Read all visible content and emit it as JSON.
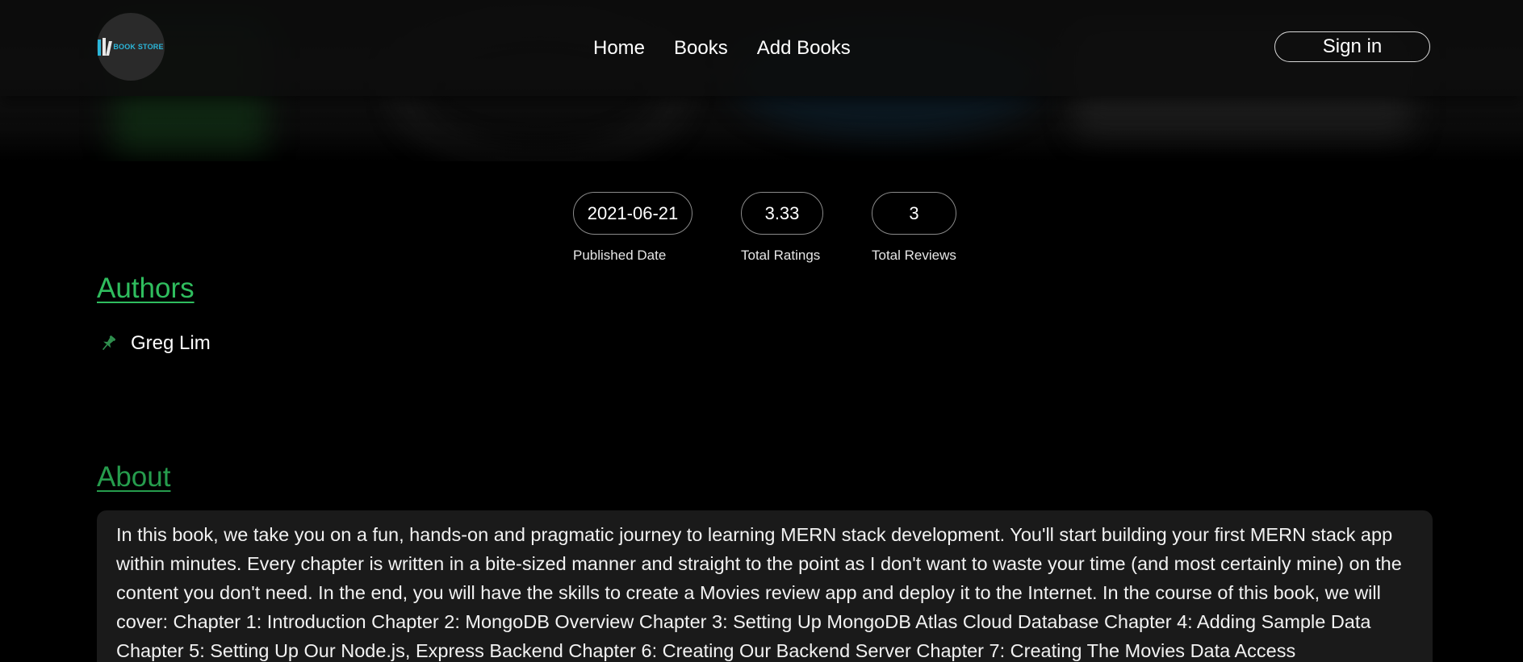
{
  "logo": {
    "text": "BOOK STORE",
    "icon": "book-stack-icon",
    "accent": "#2bb6d9"
  },
  "nav": {
    "links": [
      "Home",
      "Books",
      "Add Books"
    ],
    "signin_label": "Sign in"
  },
  "stats": [
    {
      "value": "2021-06-21",
      "label": "Published Date"
    },
    {
      "value": "3.33",
      "label": "Total Ratings"
    },
    {
      "value": "3",
      "label": "Total Reviews"
    }
  ],
  "authors": {
    "title": "Authors",
    "icon": "pin-icon",
    "items": [
      "Greg Lim"
    ]
  },
  "about": {
    "title": "About",
    "text": "In this book, we take you on a fun, hands-on and pragmatic journey to learning MERN stack development. You'll start building your first MERN stack app within minutes. Every chapter is written in a bite-sized manner and straight to the point as I don't want to waste your time (and most certainly mine) on the content you don't need. In the end, you will have the skills to create a Movies review app and deploy it to the Internet. In the course of this book, we will cover: Chapter 1: Introduction Chapter 2: MongoDB Overview Chapter 3: Setting Up MongoDB Atlas Cloud Database Chapter 4: Adding Sample Data Chapter 5: Setting Up Our Node.js, Express Backend Chapter 6: Creating Our Backend Server Chapter 7: Creating The Movies Data Access"
  },
  "colors": {
    "background": "#000000",
    "heading_green": "#2fbd5e",
    "about_green": "#269c4d",
    "card_bg": "#1a1a1a"
  }
}
